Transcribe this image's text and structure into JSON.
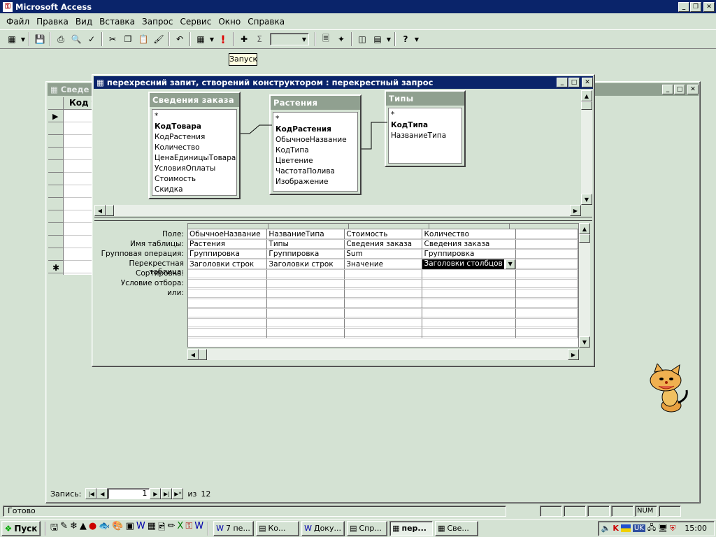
{
  "app": {
    "title": "Microsoft Access"
  },
  "menu": [
    "Файл",
    "Правка",
    "Вид",
    "Вставка",
    "Запрос",
    "Сервис",
    "Окно",
    "Справка"
  ],
  "tooltip": "Запуск",
  "back_window": {
    "title": "Сведения заказа : таблица",
    "title_visible": "Сведе",
    "column_header": "Код т"
  },
  "query_window": {
    "title": "перехресний запит, створений конструктором : перекрестный запрос",
    "tables": [
      {
        "name": "Сведения заказа",
        "fields": [
          "*",
          "КодТовара",
          "КодРастения",
          "Количество",
          "ЦенаЕдиницыТовара",
          "УсловияОплаты",
          "Стоимость",
          "Скидка"
        ],
        "bold": [
          "КодТовара"
        ]
      },
      {
        "name": "Растения",
        "fields": [
          "*",
          "КодРастения",
          "ОбычноеНазвание",
          "КодТипа",
          "Цветение",
          "ЧастотаПолива",
          "Изображение"
        ],
        "bold": [
          "КодРастения"
        ]
      },
      {
        "name": "Типы",
        "fields": [
          "*",
          "КодТипа",
          "НазваниеТипа"
        ],
        "bold": [
          "КодТипа"
        ]
      }
    ],
    "row_labels": [
      "Поле:",
      "Имя таблицы:",
      "Групповая операция:",
      "Перекрестная таблица:",
      "Сортировка:",
      "Условие отбора:",
      "или:"
    ],
    "columns": [
      [
        "ОбычноеНазвание",
        "Растения",
        "Группировка",
        "Заголовки строк"
      ],
      [
        "НазваниеТипа",
        "Типы",
        "Группировка",
        "Заголовки строк"
      ],
      [
        "Стоимость",
        "Сведения заказа",
        "Sum",
        "Значение"
      ],
      [
        "Количество",
        "Сведения заказа",
        "Группировка",
        "Заголовки столбцов"
      ],
      [
        "",
        "",
        "",
        ""
      ]
    ]
  },
  "record_nav": {
    "label": "Запись:",
    "current": "1",
    "of_label": "из",
    "total": "12"
  },
  "status": {
    "text": "Готово",
    "num": "NUM"
  },
  "taskbar": {
    "start": "Пуск",
    "tasks": [
      "7 пе...",
      "Ко...",
      "Доку...",
      "Спр...",
      "пер...",
      "Све..."
    ],
    "active_task": 4,
    "lang": "UK",
    "clock": "15:00"
  },
  "colors": {
    "desktop": "#d4e2d3",
    "title_active": "#0a246a",
    "title_inactive": "#90a090"
  }
}
